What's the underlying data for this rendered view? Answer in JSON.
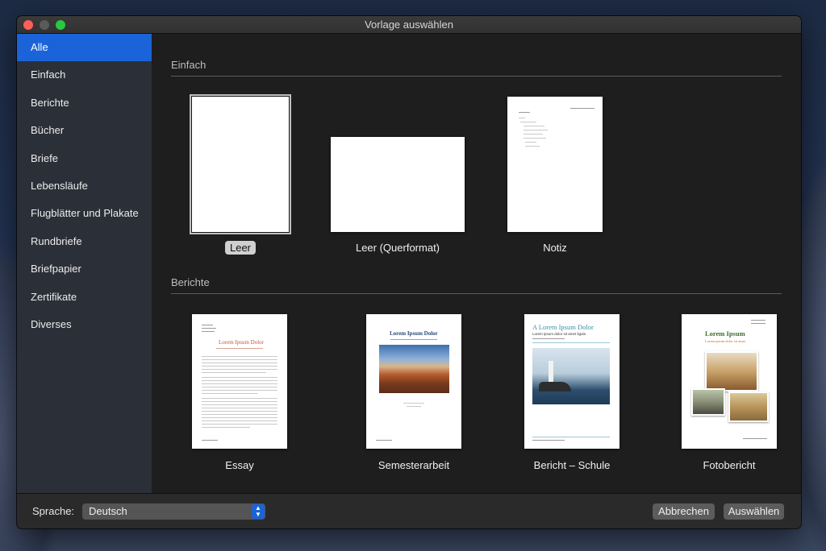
{
  "window": {
    "title": "Vorlage auswählen"
  },
  "sidebar": {
    "items": [
      {
        "label": "Alle",
        "selected": true
      },
      {
        "label": "Einfach"
      },
      {
        "label": "Berichte"
      },
      {
        "label": "Bücher"
      },
      {
        "label": "Briefe"
      },
      {
        "label": "Lebensläufe"
      },
      {
        "label": "Flugblätter und Plakate"
      },
      {
        "label": "Rundbriefe"
      },
      {
        "label": "Briefpapier"
      },
      {
        "label": "Zertifikate"
      },
      {
        "label": "Diverses"
      }
    ]
  },
  "sections": {
    "einfach": {
      "title": "Einfach",
      "templates": [
        {
          "label": "Leer",
          "selected": true
        },
        {
          "label": "Leer (Querformat)"
        },
        {
          "label": "Notiz"
        }
      ]
    },
    "berichte": {
      "title": "Berichte",
      "templates": [
        {
          "label": "Essay",
          "thumb_title": "Lorem Ipsum Dolor"
        },
        {
          "label": "Semesterarbeit",
          "thumb_title": "Lorem Ipsum Dolor"
        },
        {
          "label": "Bericht – Schule",
          "thumb_title": "A Lorem Ipsum Dolor",
          "thumb_subtitle": "Lorem ipsum dolor sit amet ligula"
        },
        {
          "label": "Fotobericht",
          "thumb_title": "Lorem Ipsum",
          "thumb_subtitle": "Lorem ipsum dolor sit amet"
        }
      ]
    }
  },
  "footer": {
    "language_label": "Sprache:",
    "language_value": "Deutsch",
    "cancel_label": "Abbrechen",
    "choose_label": "Auswählen"
  },
  "colors": {
    "accent": "#1a63d8",
    "sidebar_bg": "#2b2f38",
    "content_bg": "#1e1e1e",
    "essay_title": "#c0583c",
    "semester_title": "#2a4a7a",
    "school_title": "#3a8fa8",
    "photo_title": "#3f6e2e"
  }
}
